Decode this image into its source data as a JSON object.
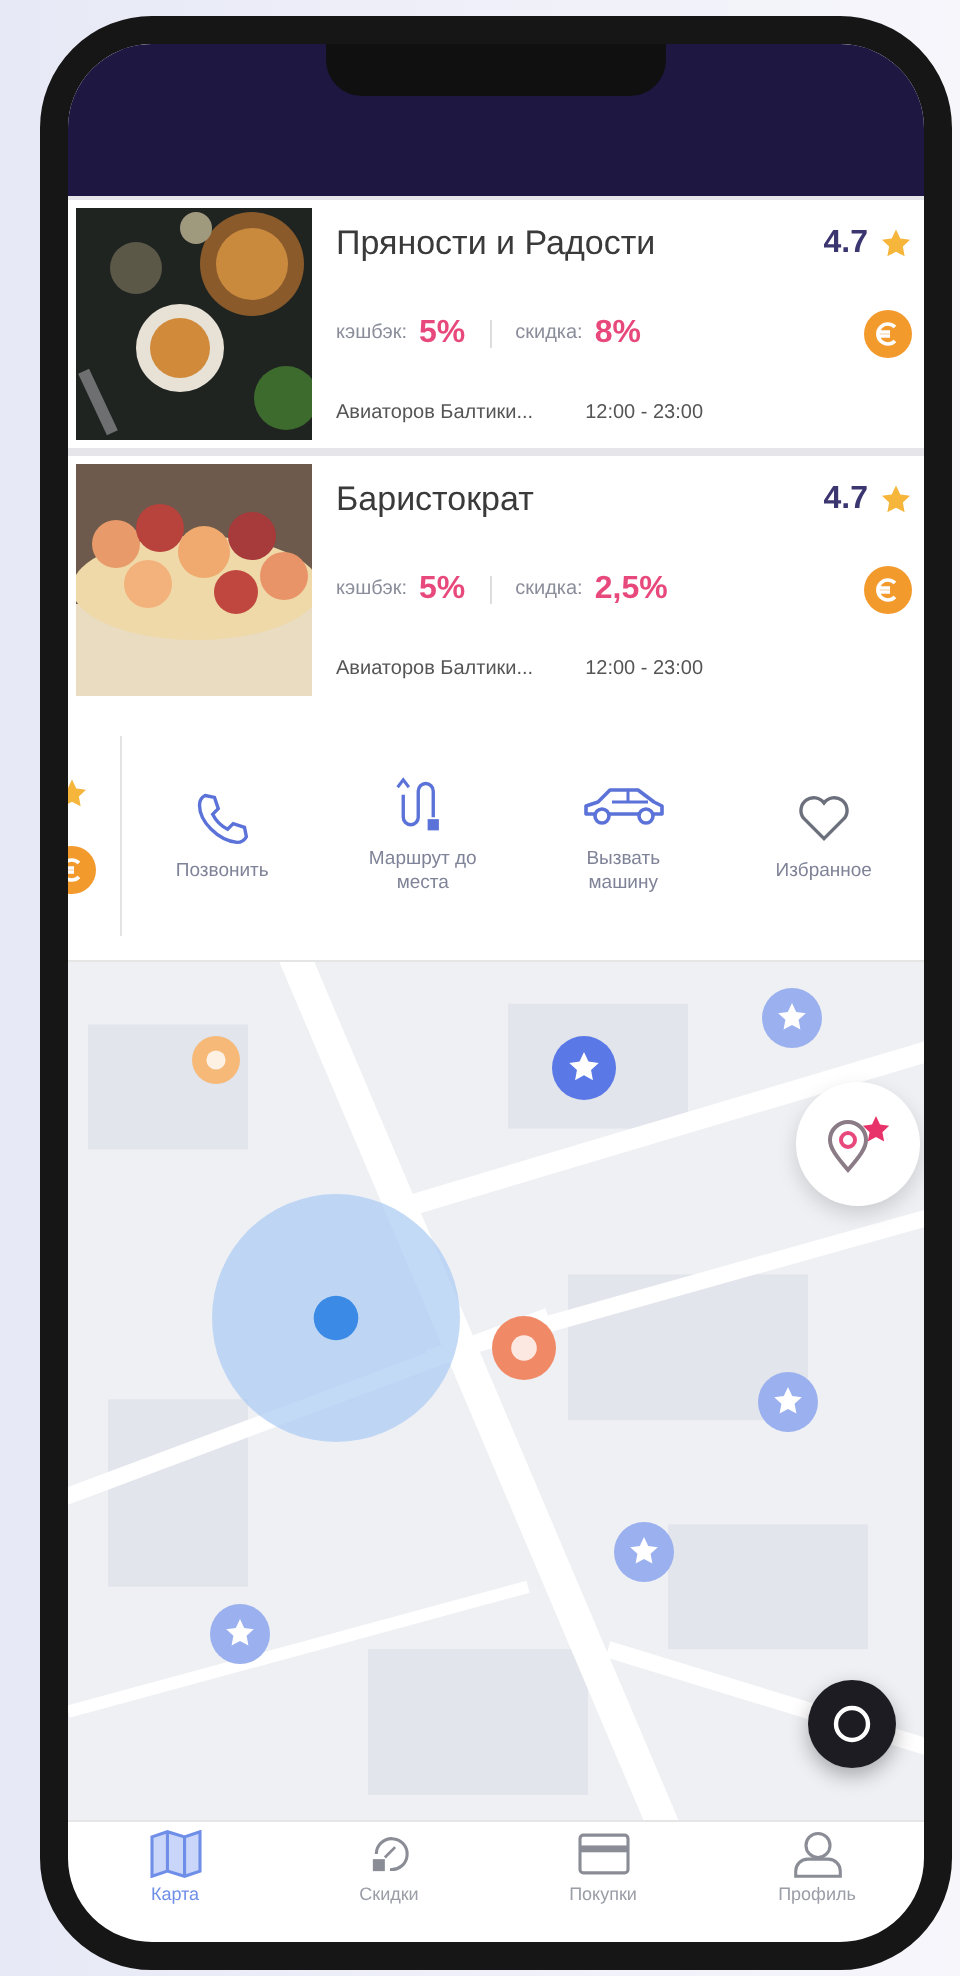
{
  "places": [
    {
      "name": "Пряности и Радости",
      "rating": "4.7",
      "cashback_label": "кэшбэк:",
      "cashback": "5%",
      "discount_label": "скидка:",
      "discount": "8%",
      "address": "Авиаторов Балтики...",
      "hours": "12:00 - 23:00"
    },
    {
      "name": "Баристократ",
      "rating": "4.7",
      "cashback_label": "кэшбэк:",
      "cashback": "5%",
      "discount_label": "скидка:",
      "discount": "2,5%",
      "address": "Авиаторов Балтики...",
      "hours": "12:00 - 23:00"
    }
  ],
  "actions": [
    {
      "kind": "phone",
      "label": "Позвонить"
    },
    {
      "kind": "route",
      "label": "Маршрут до места"
    },
    {
      "kind": "car",
      "label": "Вызвать машину"
    },
    {
      "kind": "heart",
      "label": "Избранное"
    }
  ],
  "tabs": [
    {
      "kind": "map",
      "label": "Карта",
      "selected": true
    },
    {
      "kind": "discount",
      "label": "Скидки",
      "selected": false
    },
    {
      "kind": "card",
      "label": "Покупки",
      "selected": false
    },
    {
      "kind": "profile",
      "label": "Профиль",
      "selected": false
    }
  ]
}
